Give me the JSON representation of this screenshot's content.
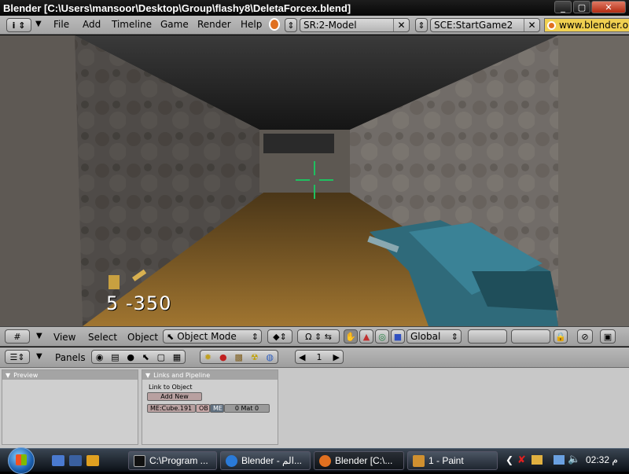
{
  "window": {
    "title": "Blender [C:\\Users\\mansoor\\Desktop\\Group\\flashy8\\DeletaForcex.blend]"
  },
  "header": {
    "info_icon": "info-icon",
    "menus": [
      "File",
      "Add",
      "Timeline",
      "Game",
      "Render",
      "Help"
    ],
    "screen": "SR:2-Model",
    "scene": "SCE:StartGame2",
    "url": "www.blender.org"
  },
  "hud": {
    "ammo_text": "5  -350"
  },
  "view_header": {
    "menus": [
      "View",
      "Select",
      "Object"
    ],
    "mode": "Object Mode",
    "orientation": "Global"
  },
  "buttons_header": {
    "panels_label": "Panels",
    "frame": "1"
  },
  "panels": {
    "preview_title": "Preview",
    "links_title": "Links and Pipeline",
    "link_to_object": "Link to Object",
    "add_new": "Add New",
    "mesh_name": "ME:Cube.191",
    "ob_label": "OB",
    "me_label": "ME",
    "mat_label": "0 Mat 0"
  },
  "taskbar": {
    "tasks": [
      "C:\\Program ...",
      "Blender - الم...",
      "Blender [C:\\...",
      "1 - Paint"
    ],
    "clock": "02:32 م"
  },
  "colors": {
    "crosshair": "#1fc060",
    "url_bg": "#f0d050",
    "close_btn": "#c8462a"
  }
}
